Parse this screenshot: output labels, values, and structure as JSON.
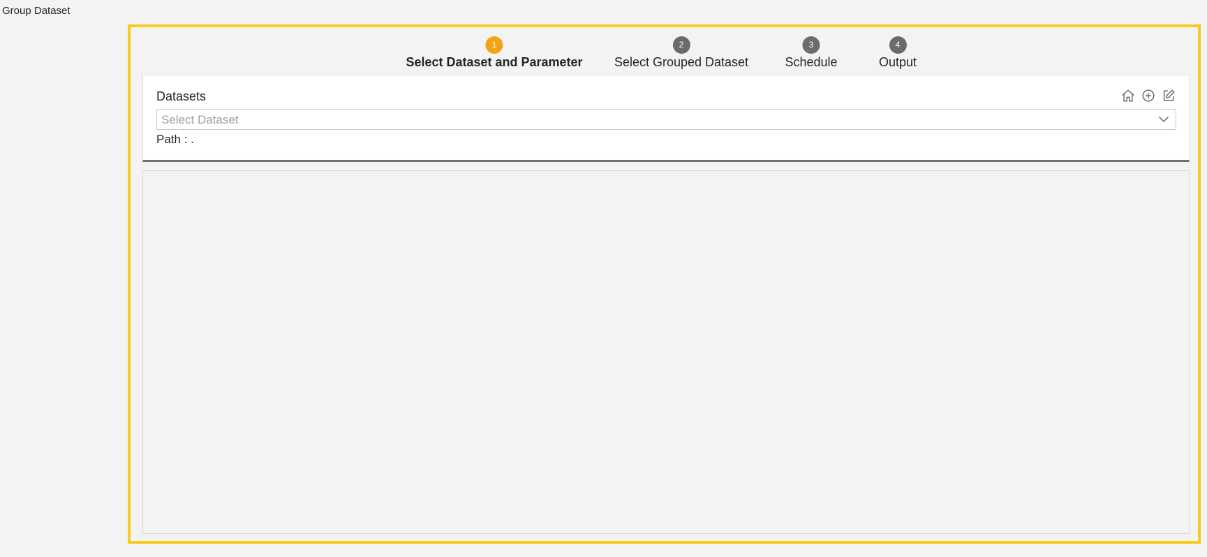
{
  "page": {
    "title": "Group Dataset"
  },
  "colors": {
    "frame_border": "#f8cc1b",
    "active_step": "#f5a316",
    "inactive_step": "#6b6b6b"
  },
  "stepper": {
    "steps": [
      {
        "number": "1",
        "label": "Select Dataset and Parameter",
        "active": true
      },
      {
        "number": "2",
        "label": "Select Grouped Dataset",
        "active": false
      },
      {
        "number": "3",
        "label": "Schedule",
        "active": false
      },
      {
        "number": "4",
        "label": "Output",
        "active": false
      }
    ]
  },
  "datasets": {
    "label": "Datasets",
    "placeholder": "Select Dataset",
    "path_label": "Path :",
    "path_value": ".",
    "tools": [
      "home-icon",
      "add-circle-icon",
      "edit-icon"
    ]
  }
}
